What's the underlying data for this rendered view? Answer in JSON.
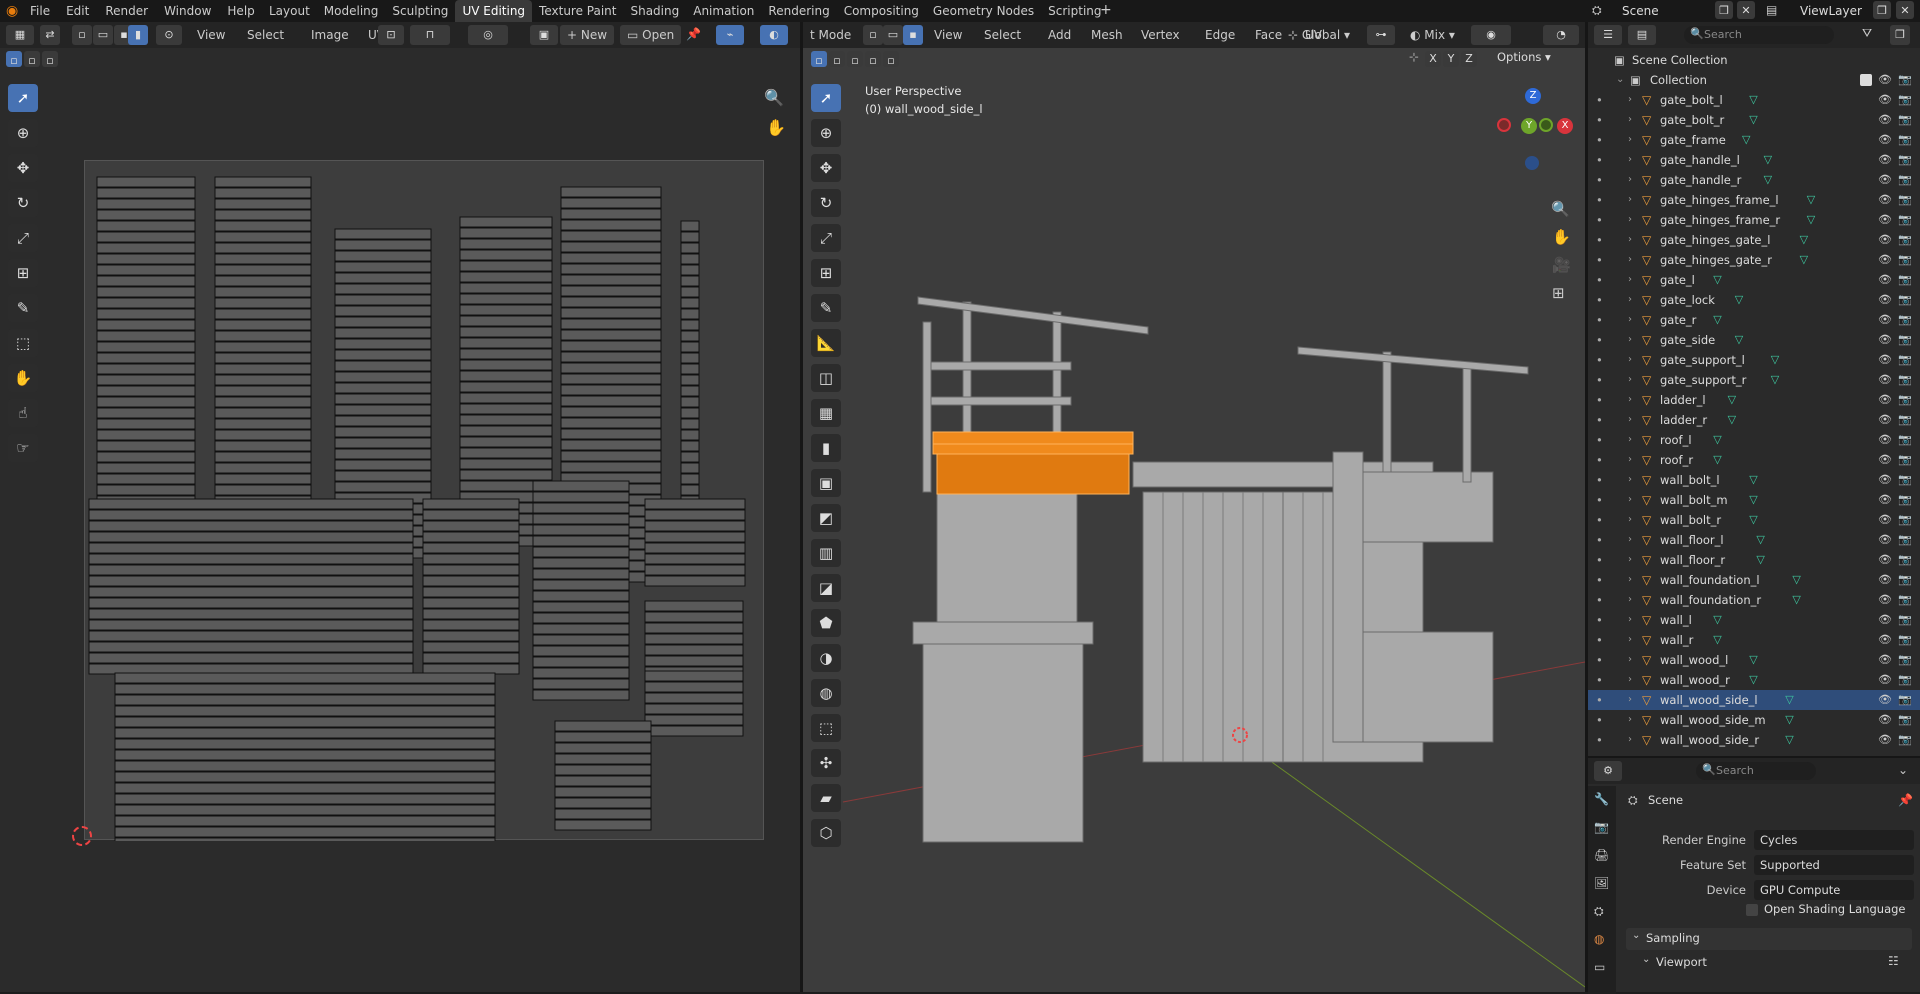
{
  "menu": [
    "File",
    "Edit",
    "Render",
    "Window",
    "Help"
  ],
  "workspaces": [
    "Layout",
    "Modeling",
    "Sculpting",
    "UV Editing",
    "Texture Paint",
    "Shading",
    "Animation",
    "Rendering",
    "Compositing",
    "Geometry Nodes",
    "Scripting"
  ],
  "active_workspace": "UV Editing",
  "plus": "+",
  "scene": {
    "label": "Scene",
    "viewlayer": "ViewLayer"
  },
  "uv": {
    "menus": [
      "View",
      "Select",
      "Image",
      "UV"
    ],
    "new_label": "New",
    "open_label": "Open"
  },
  "viewport": {
    "mode": "t Mode",
    "menus": [
      "View",
      "Select",
      "Add",
      "Mesh",
      "Vertex",
      "Edge",
      "Face",
      "UV"
    ],
    "orientation": "Global",
    "snap_mode": "Mix",
    "options": "Options",
    "perspective": "User Perspective",
    "object": "(0) wall_wood_side_l",
    "axis_x": "X",
    "axis_y": "Y",
    "axis_z": "Z",
    "gizmo_x": "X",
    "gizmo_y": "Y",
    "gizmo_z": "Z"
  },
  "outliner": {
    "search_placeholder": "Search",
    "scene_collection": "Scene Collection",
    "collection": "Collection",
    "items": [
      "gate_bolt_l",
      "gate_bolt_r",
      "gate_frame",
      "gate_handle_l",
      "gate_handle_r",
      "gate_hinges_frame_l",
      "gate_hinges_frame_r",
      "gate_hinges_gate_l",
      "gate_hinges_gate_r",
      "gate_l",
      "gate_lock",
      "gate_r",
      "gate_side",
      "gate_support_l",
      "gate_support_r",
      "ladder_l",
      "ladder_r",
      "roof_l",
      "roof_r",
      "wall_bolt_l",
      "wall_bolt_m",
      "wall_bolt_r",
      "wall_floor_l",
      "wall_floor_r",
      "wall_foundation_l",
      "wall_foundation_r",
      "wall_l",
      "wall_r",
      "wall_wood_l",
      "wall_wood_r",
      "wall_wood_side_l",
      "wall_wood_side_m",
      "wall_wood_side_r"
    ],
    "selected": "wall_wood_side_l"
  },
  "properties": {
    "search_placeholder": "Search",
    "context": "Scene",
    "rows": [
      {
        "label": "Render Engine",
        "value": "Cycles"
      },
      {
        "label": "Feature Set",
        "value": "Supported"
      },
      {
        "label": "Device",
        "value": "GPU Compute"
      }
    ],
    "osl": "Open Shading Language",
    "sampling": "Sampling",
    "viewport": "Viewport"
  },
  "colors": {
    "accent": "#4772b3",
    "selected_orange": "#f08a1c",
    "mesh_icon": "#3ec8a0"
  }
}
